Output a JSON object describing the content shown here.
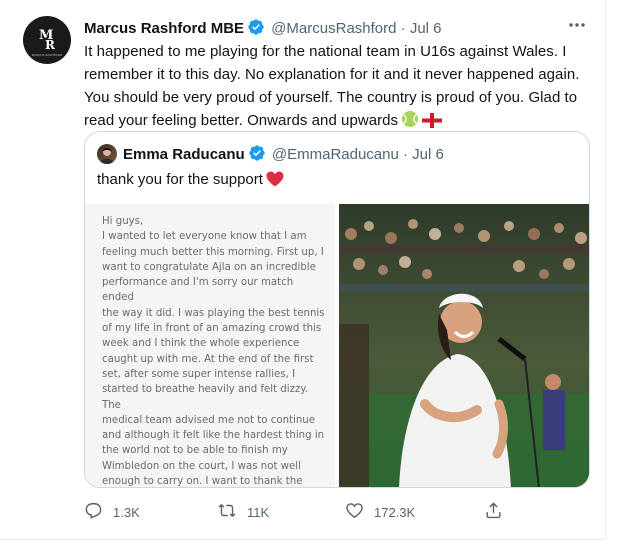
{
  "tweet": {
    "author_name": "Marcus Rashford MBE",
    "author_handle": "@MarcusRashford",
    "separator": "·",
    "date": "Jul 6",
    "body": "It happened to me playing for the national team in U16s against Wales. I remember it to this day. No explanation for it and it never happened again. You should be very proud of yourself. The country is proud of you. Glad to read your feeling better. Onwards and upwards",
    "avatar_logo": "MR",
    "avatar_logo_caption": "MARCUS RASHFORD"
  },
  "quoted_tweet": {
    "author_name": "Emma Raducanu",
    "author_handle": "@EmmaRaducanu",
    "separator": "·",
    "date": "Jul 6",
    "text": "thank you for the support",
    "letter_text": "Hi guys,\nI wanted to let everyone know that I am\nfeeling much better this morning. First up, I\nwant to congratulate Ajla on an incredible\nperformance and I'm sorry our match ended\nthe way it did. I was playing the best tennis\nof my life in front of an amazing crowd this\nweek and I think the whole experience\ncaught up with me. At the end of the first\nset, after some super intense rallies, I\nstarted to breathe heavily and felt dizzy. The\nmedical team advised me not to continue\nand although it felt like the hardest thing in\nthe world not to be able to finish my\nWimbledon on the court, I was not well\nenough to carry on. I want to thank the\npeople who have cheered me on every single\nmatch, I wanted to win so badly for you! I\nwill learn from this experience and hope"
  },
  "actions": {
    "reply_count": "1.3K",
    "retweet_count": "11K",
    "like_count": "172.3K"
  },
  "icons": {
    "verified": "verified-badge-icon",
    "more": "more-options-icon",
    "reply": "reply-icon",
    "retweet": "retweet-icon",
    "like": "like-icon",
    "share": "share-icon",
    "tennis_ball": "tennis-ball-emoji",
    "england_flag": "england-flag-emoji",
    "heart": "red-heart-emoji"
  },
  "colors": {
    "verified_blue": "#1d9bf0",
    "text_primary": "#0f1419",
    "text_secondary": "#536471",
    "border": "#cfd9de"
  }
}
